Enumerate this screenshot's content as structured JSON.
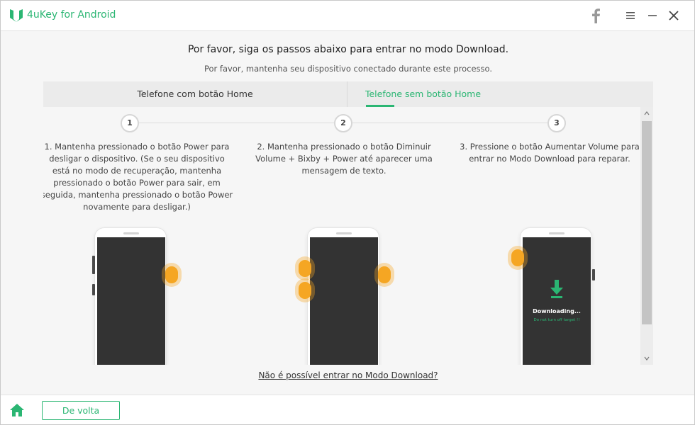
{
  "app": {
    "title": "4uKey for Android",
    "accent": "#2bb673"
  },
  "header": {
    "title": "Por favor, siga os passos abaixo para entrar no modo Download.",
    "subtitle": "Por favor, mantenha seu dispositivo conectado durante este processo."
  },
  "tabs": [
    {
      "label": "Telefone com botão Home",
      "active": false
    },
    {
      "label": "Telefone sem botão Home",
      "active": true
    }
  ],
  "steps": [
    {
      "number": "1",
      "text": "1. Mantenha pressionado o botão Power para desligar o dispositivo. (Se o seu dispositivo está no modo de recuperação, mantenha pressionado o botão Power para sair, em seguida, mantenha pressionado o botão Power novamente para desligar.)"
    },
    {
      "number": "2",
      "text": "2. Mantenha pressionado o botão Diminuir Volume + Bixby + Power até aparecer uma mensagem de texto."
    },
    {
      "number": "3",
      "text": "3. Pressione o botão Aumentar Volume para entrar no Modo Download para reparar."
    }
  ],
  "phone3": {
    "screen_title": "Downloading...",
    "screen_sub": "Do not turn off target !!"
  },
  "download_link": "Não é possível entrar no Modo Download?",
  "footer": {
    "back_label": "De volta"
  },
  "icons": [
    "logo-icon",
    "facebook-icon",
    "menu-icon",
    "minimize-icon",
    "close-icon",
    "home-icon",
    "download-arrow-icon"
  ]
}
